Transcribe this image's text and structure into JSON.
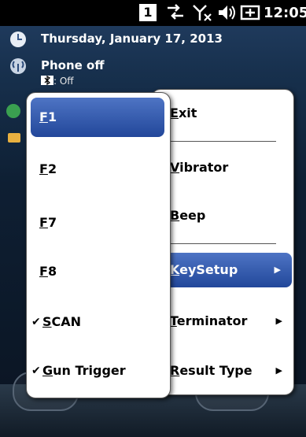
{
  "status_bar": {
    "indicator": "1",
    "icons": [
      "sync-arrows-icon",
      "no-signal-icon",
      "speaker-icon",
      "battery-plug-icon"
    ],
    "clock": "12:05"
  },
  "today": {
    "date": "Thursday, January 17, 2013",
    "phone_status": "Phone off",
    "bluetooth_status": ": Off"
  },
  "main_menu": {
    "items": [
      {
        "first": "E",
        "rest": "xit"
      },
      {
        "first": "V",
        "rest": "ibrator"
      },
      {
        "first": "B",
        "rest": "eep"
      },
      {
        "first": "K",
        "rest": "eySetup",
        "submenu": true,
        "selected": true
      },
      {
        "first": "T",
        "rest": "erminator",
        "submenu": true
      },
      {
        "first": "R",
        "rest": "esult Type",
        "submenu": true
      }
    ]
  },
  "sub_menu": {
    "items": [
      {
        "first": "F",
        "rest": "1",
        "selected": true
      },
      {
        "first": "F",
        "rest": "2"
      },
      {
        "first": "F",
        "rest": "7"
      },
      {
        "first": "F",
        "rest": "8"
      },
      {
        "first": "S",
        "rest": "CAN",
        "checked": true
      },
      {
        "first": "G",
        "rest": "un Trigger",
        "checked": true
      }
    ]
  },
  "glyphs": {
    "check": "✔",
    "arrow": "▶"
  },
  "colors": {
    "selection": "#2e54a8",
    "menu_background": "#ffffff",
    "status_bar": "#000000"
  }
}
